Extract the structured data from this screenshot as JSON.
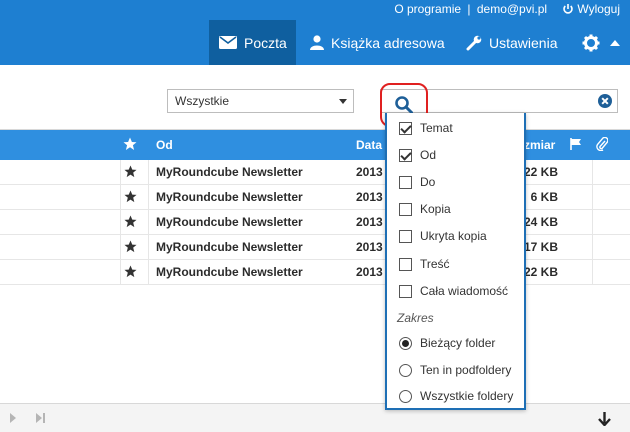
{
  "header": {
    "about": "O programie",
    "separator": "|",
    "user": "demo@pvi.pl",
    "logout": "Wyloguj",
    "nav": [
      "Poczta",
      "Książka adresowa",
      "Ustawienia"
    ]
  },
  "toolbar": {
    "filter_value": "Wszystkie"
  },
  "table": {
    "headers": {
      "from": "Od",
      "date": "Data",
      "size": "zmiar"
    },
    "rows": [
      {
        "from": "MyRoundcube Newsletter",
        "date": "2013",
        "size": "22 KB"
      },
      {
        "from": "MyRoundcube Newsletter",
        "date": "2013",
        "size": "6 KB"
      },
      {
        "from": "MyRoundcube Newsletter",
        "date": "2013",
        "size": "24 KB"
      },
      {
        "from": "MyRoundcube Newsletter",
        "date": "2013",
        "size": "17 KB"
      },
      {
        "from": "MyRoundcube Newsletter",
        "date": "2013",
        "size": "22 KB"
      }
    ]
  },
  "search_menu": {
    "fields": [
      {
        "label": "Temat",
        "checked": true
      },
      {
        "label": "Od",
        "checked": true
      },
      {
        "label": "Do",
        "checked": false
      },
      {
        "label": "Kopia",
        "checked": false
      },
      {
        "label": "Ukryta kopia",
        "checked": false
      },
      {
        "label": "Treść",
        "checked": false
      },
      {
        "label": "Cała wiadomość",
        "checked": false
      }
    ],
    "scope_label": "Zakres",
    "scope": [
      {
        "label": "Bieżący folder",
        "checked": true
      },
      {
        "label": "Ten in podfoldery",
        "checked": false
      },
      {
        "label": "Wszystkie foldery",
        "checked": false
      }
    ]
  },
  "colors": {
    "header": "#1e7fd1",
    "active_nav": "#0f5f9f",
    "table_header": "#2f8fe0",
    "highlight": "#e02020"
  }
}
